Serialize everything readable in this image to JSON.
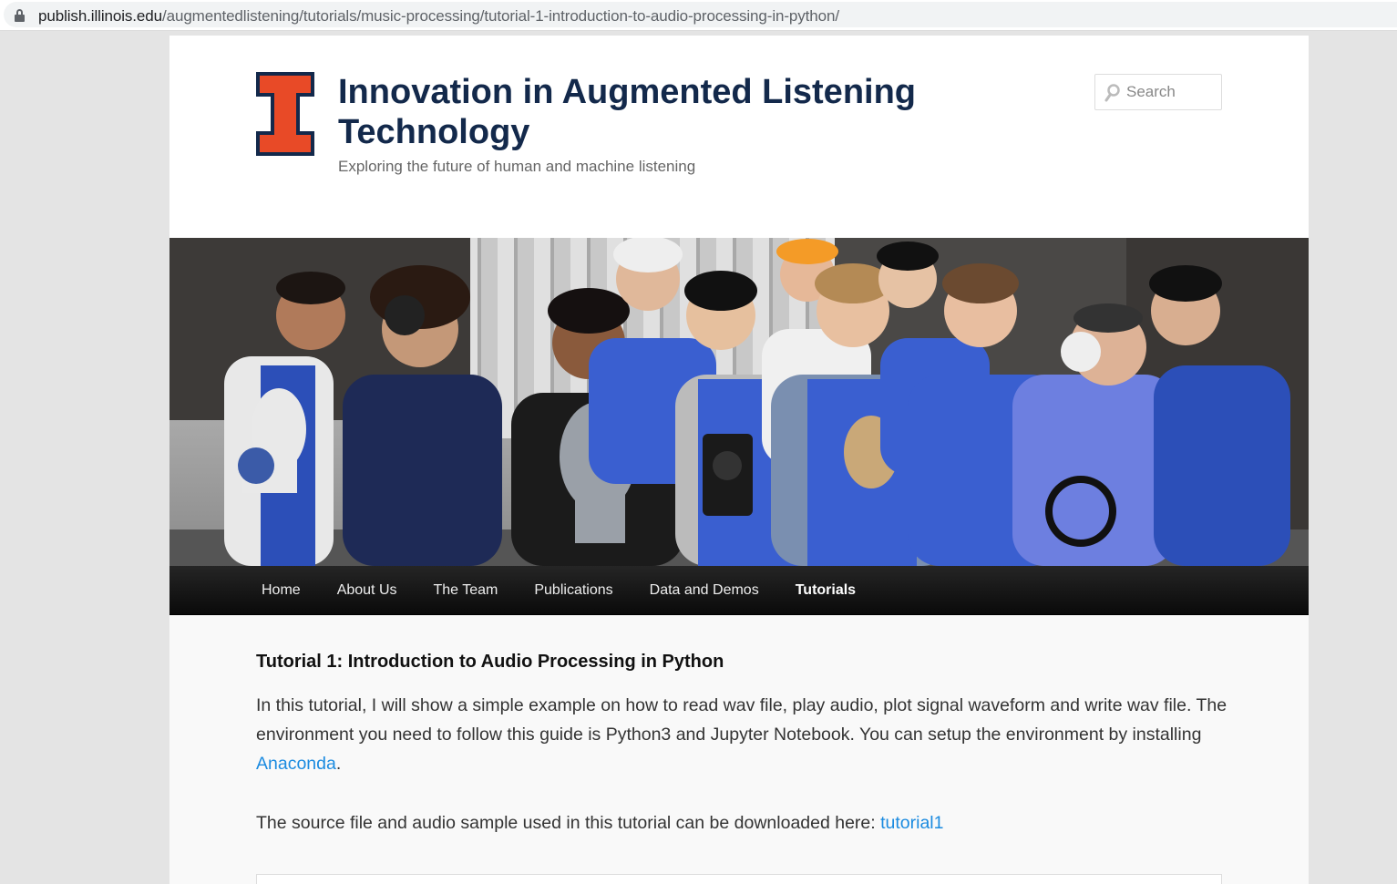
{
  "browser": {
    "url_host": "publish.illinois.edu",
    "url_path": "/augmentedlistening/tutorials/music-processing/tutorial-1-introduction-to-audio-processing-in-python/",
    "lock_icon": "lock-icon"
  },
  "site": {
    "logo_icon": "illinois-block-i-logo",
    "title": "Innovation in Augmented Listening Technology",
    "description": "Exploring the future of human and machine listening"
  },
  "search": {
    "placeholder": "Search",
    "icon": "search-icon"
  },
  "banner": {
    "image": "team-group-photo"
  },
  "nav": {
    "items": [
      {
        "label": "Home"
      },
      {
        "label": "About Us"
      },
      {
        "label": "The Team"
      },
      {
        "label": "Publications"
      },
      {
        "label": "Data and Demos"
      },
      {
        "label": "Tutorials"
      }
    ],
    "active": "Tutorials"
  },
  "article": {
    "title": "Tutorial 1: Introduction to Audio Processing in Python",
    "p1_text": "In this tutorial, I will show a simple example on how to read wav file, play audio, plot signal waveform and write wav file. The environment you need to follow this guide is Python3 and Jupyter Notebook. You can setup the environment by installing ",
    "p1_link": "Anaconda",
    "p1_end": ".",
    "p2_text": "The source file and audio sample used in this tutorial can be downloaded here: ",
    "p2_link": "tutorial1"
  },
  "colors": {
    "illinois_orange": "#e84a27",
    "illinois_blue": "#13294b",
    "link": "#1b8be0"
  }
}
